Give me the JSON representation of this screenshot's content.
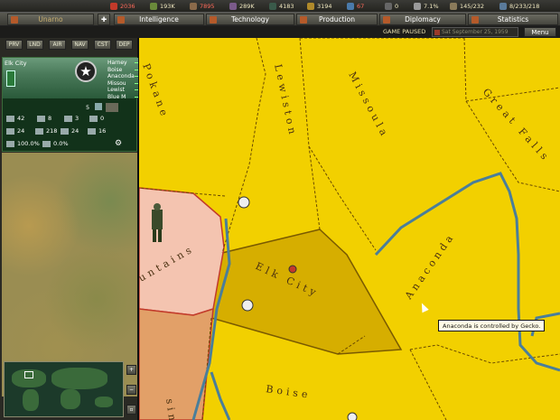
{
  "resources": [
    {
      "name": "money",
      "value": "2036",
      "negative": true,
      "color": "#c23a2a"
    },
    {
      "name": "food",
      "value": "193K",
      "negative": false,
      "color": "#6a8a3a"
    },
    {
      "name": "raw-materials",
      "value": "7895",
      "negative": true,
      "color": "#8a6a4a"
    },
    {
      "name": "goods",
      "value": "289K",
      "negative": false,
      "color": "#7a5a8a"
    },
    {
      "name": "oil",
      "value": "4183",
      "negative": false,
      "color": "#3a5a4a"
    },
    {
      "name": "cash",
      "value": "3194",
      "negative": false,
      "color": "#b08a2a"
    },
    {
      "name": "research",
      "value": "67",
      "negative": true,
      "color": "#4a7aaa"
    },
    {
      "name": "alert",
      "value": "0",
      "negative": false,
      "color": "#666"
    },
    {
      "name": "approval",
      "value": "7.1%",
      "negative": false,
      "color": "#9a9a9a"
    },
    {
      "name": "population",
      "value": "145/232",
      "negative": false,
      "color": "#8a7a5a"
    },
    {
      "name": "military",
      "value": "8/233/218",
      "negative": false,
      "color": "#5a7a9a"
    }
  ],
  "menubar": {
    "nation": "Unarno",
    "buttons": [
      "Intelligence",
      "Technology",
      "Production",
      "Diplomacy",
      "Statistics"
    ]
  },
  "status": {
    "paused": "GAME PAUSED",
    "date": "Sat September 25, 1959",
    "menu": "Menu"
  },
  "filters": [
    "PRV",
    "LND",
    "AIR",
    "NAV",
    "CST",
    "DEP"
  ],
  "city": {
    "name": "Elk City",
    "neighbors": [
      "Harney",
      "Boise",
      "Anaconda",
      "Missou",
      "Lewist",
      "Blue M"
    ],
    "unit_count": "5",
    "stats_row1": [
      {
        "icon": "factory-icon",
        "value": "42"
      },
      {
        "icon": "tool-icon",
        "value": "8"
      },
      {
        "icon": "gear-icon",
        "value": "3"
      },
      {
        "icon": "tank-icon",
        "value": "0"
      }
    ],
    "stats_row2": [
      {
        "icon": "wheat-icon",
        "value": "24"
      },
      {
        "icon": "drop-icon",
        "value": "218"
      },
      {
        "icon": "rock-icon",
        "value": "24"
      },
      {
        "icon": "crate-icon",
        "value": "16"
      }
    ],
    "stats_row3": [
      {
        "icon": "grain-icon",
        "value": "100.0%"
      },
      {
        "icon": "ship-icon",
        "value": "0.0%"
      }
    ]
  },
  "map": {
    "regions": [
      "Pokane",
      "Lewiston",
      "Missoula",
      "Great Falls",
      "Anaconda",
      "Elk City",
      "Boise",
      "untains",
      "sin"
    ],
    "colors": {
      "own": "#f2d000",
      "own_dark": "#d6ae00",
      "enemy": "#f4c4b0",
      "enemy2": "#e2a068",
      "river": "#4a7e9a"
    }
  },
  "tooltip": "Anaconda is controlled by Gecko."
}
